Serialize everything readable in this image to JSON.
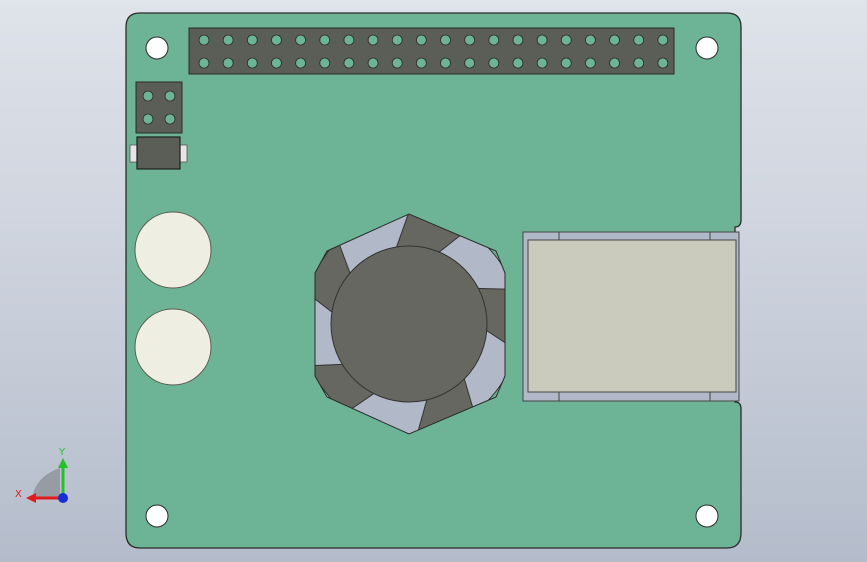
{
  "view": {
    "background_top": "#dfe3ea",
    "background_bottom": "#b4bccb"
  },
  "board": {
    "pcb_color": "#6db396",
    "outline_color": "#2b2b2b",
    "mounting_holes": 4
  },
  "gpio_header": {
    "rows": 2,
    "pins_per_row": 20,
    "body_color": "#5a5e57",
    "pin_color": "#6db396"
  },
  "small_header": {
    "rows": 2,
    "cols": 2,
    "body_color": "#5a5e57"
  },
  "smd_component": {
    "body_color": "#5a5e57"
  },
  "buzzers": {
    "count": 2,
    "color": "#eeeee2"
  },
  "fan": {
    "housing_color": "#b1b8c7",
    "hub_color": "#656760",
    "blades": 5
  },
  "connector": {
    "frame_color": "#b1b8c7",
    "insert_color": "#cbcbbd"
  },
  "triad": {
    "x_label": "X",
    "y_label": "Y",
    "x_color": "#e21c1c",
    "y_color": "#23c22a",
    "z_color": "#1a2ed6"
  }
}
